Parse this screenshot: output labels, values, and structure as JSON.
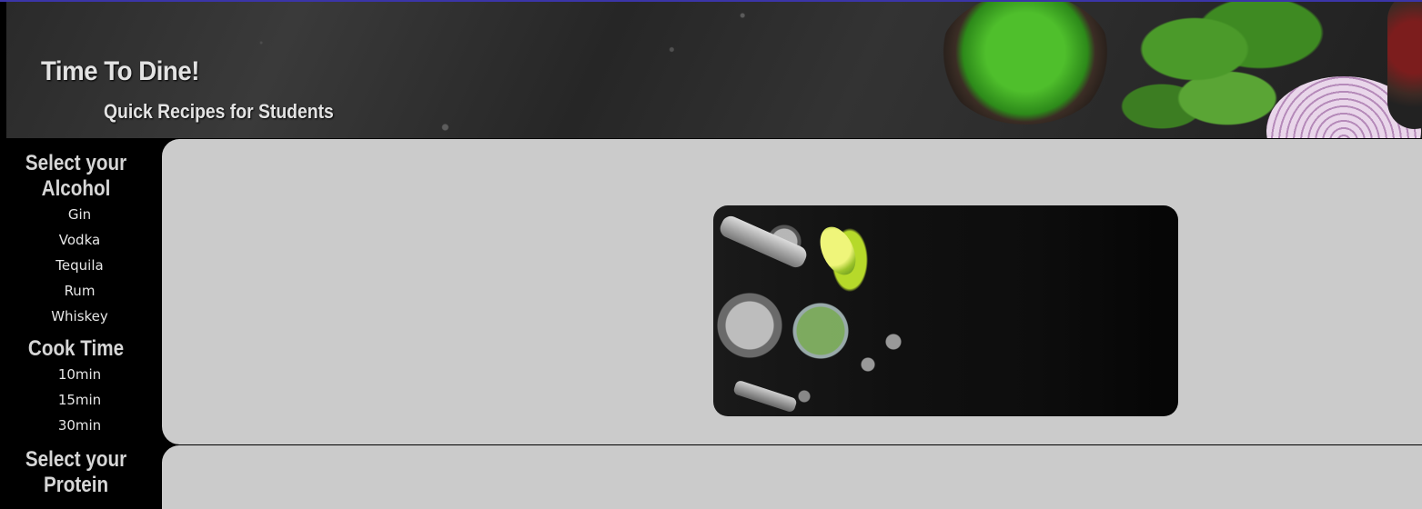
{
  "header": {
    "title": "Time To Dine!",
    "subtitle": "Quick Recipes for Students"
  },
  "sidebar": {
    "sections": [
      {
        "heading": "Select your Alcohol",
        "items": [
          "Gin",
          "Vodka",
          "Tequila",
          "Rum",
          "Whiskey"
        ]
      },
      {
        "heading": "Cook Time",
        "items": [
          "10min",
          "15min",
          "30min"
        ]
      },
      {
        "heading": "Select your Protein",
        "items": []
      }
    ]
  },
  "colors": {
    "top_border": "#3b35a8",
    "sidebar_bg": "#000000",
    "panel_bg": "#cbcbcb",
    "text_light": "#e6e6e6"
  },
  "main": {
    "hero_image": "cocktail-ingredients-image"
  }
}
